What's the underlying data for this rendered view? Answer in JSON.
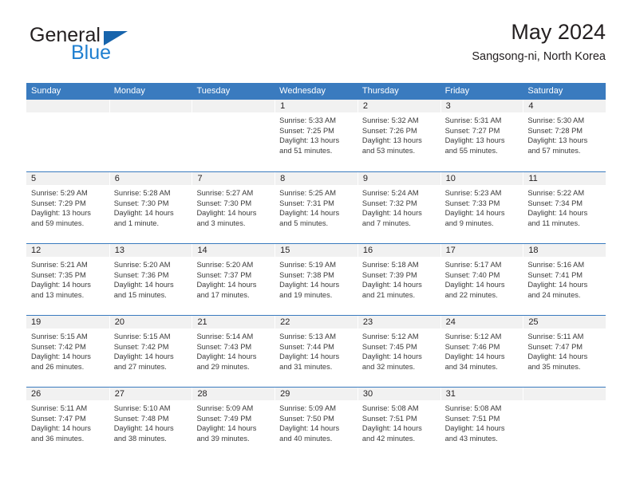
{
  "brand": {
    "name_top": "General",
    "name_bottom": "Blue",
    "accent_color": "#1764ac",
    "text_color": "#1f7fd0"
  },
  "header": {
    "title": "May 2024",
    "location": "Sangsong-ni, North Korea"
  },
  "theme": {
    "header_band": "#3a7bbf",
    "day_band": "#f1f1f1",
    "text": "#231f20",
    "body_text": "#3a3a3a"
  },
  "weekdays": [
    "Sunday",
    "Monday",
    "Tuesday",
    "Wednesday",
    "Thursday",
    "Friday",
    "Saturday"
  ],
  "weeks": [
    [
      {
        "day": "",
        "sunrise": "",
        "sunset": "",
        "daylight1": "",
        "daylight2": ""
      },
      {
        "day": "",
        "sunrise": "",
        "sunset": "",
        "daylight1": "",
        "daylight2": ""
      },
      {
        "day": "",
        "sunrise": "",
        "sunset": "",
        "daylight1": "",
        "daylight2": ""
      },
      {
        "day": "1",
        "sunrise": "Sunrise: 5:33 AM",
        "sunset": "Sunset: 7:25 PM",
        "daylight1": "Daylight: 13 hours",
        "daylight2": "and 51 minutes."
      },
      {
        "day": "2",
        "sunrise": "Sunrise: 5:32 AM",
        "sunset": "Sunset: 7:26 PM",
        "daylight1": "Daylight: 13 hours",
        "daylight2": "and 53 minutes."
      },
      {
        "day": "3",
        "sunrise": "Sunrise: 5:31 AM",
        "sunset": "Sunset: 7:27 PM",
        "daylight1": "Daylight: 13 hours",
        "daylight2": "and 55 minutes."
      },
      {
        "day": "4",
        "sunrise": "Sunrise: 5:30 AM",
        "sunset": "Sunset: 7:28 PM",
        "daylight1": "Daylight: 13 hours",
        "daylight2": "and 57 minutes."
      }
    ],
    [
      {
        "day": "5",
        "sunrise": "Sunrise: 5:29 AM",
        "sunset": "Sunset: 7:29 PM",
        "daylight1": "Daylight: 13 hours",
        "daylight2": "and 59 minutes."
      },
      {
        "day": "6",
        "sunrise": "Sunrise: 5:28 AM",
        "sunset": "Sunset: 7:30 PM",
        "daylight1": "Daylight: 14 hours",
        "daylight2": "and 1 minute."
      },
      {
        "day": "7",
        "sunrise": "Sunrise: 5:27 AM",
        "sunset": "Sunset: 7:30 PM",
        "daylight1": "Daylight: 14 hours",
        "daylight2": "and 3 minutes."
      },
      {
        "day": "8",
        "sunrise": "Sunrise: 5:25 AM",
        "sunset": "Sunset: 7:31 PM",
        "daylight1": "Daylight: 14 hours",
        "daylight2": "and 5 minutes."
      },
      {
        "day": "9",
        "sunrise": "Sunrise: 5:24 AM",
        "sunset": "Sunset: 7:32 PM",
        "daylight1": "Daylight: 14 hours",
        "daylight2": "and 7 minutes."
      },
      {
        "day": "10",
        "sunrise": "Sunrise: 5:23 AM",
        "sunset": "Sunset: 7:33 PM",
        "daylight1": "Daylight: 14 hours",
        "daylight2": "and 9 minutes."
      },
      {
        "day": "11",
        "sunrise": "Sunrise: 5:22 AM",
        "sunset": "Sunset: 7:34 PM",
        "daylight1": "Daylight: 14 hours",
        "daylight2": "and 11 minutes."
      }
    ],
    [
      {
        "day": "12",
        "sunrise": "Sunrise: 5:21 AM",
        "sunset": "Sunset: 7:35 PM",
        "daylight1": "Daylight: 14 hours",
        "daylight2": "and 13 minutes."
      },
      {
        "day": "13",
        "sunrise": "Sunrise: 5:20 AM",
        "sunset": "Sunset: 7:36 PM",
        "daylight1": "Daylight: 14 hours",
        "daylight2": "and 15 minutes."
      },
      {
        "day": "14",
        "sunrise": "Sunrise: 5:20 AM",
        "sunset": "Sunset: 7:37 PM",
        "daylight1": "Daylight: 14 hours",
        "daylight2": "and 17 minutes."
      },
      {
        "day": "15",
        "sunrise": "Sunrise: 5:19 AM",
        "sunset": "Sunset: 7:38 PM",
        "daylight1": "Daylight: 14 hours",
        "daylight2": "and 19 minutes."
      },
      {
        "day": "16",
        "sunrise": "Sunrise: 5:18 AM",
        "sunset": "Sunset: 7:39 PM",
        "daylight1": "Daylight: 14 hours",
        "daylight2": "and 21 minutes."
      },
      {
        "day": "17",
        "sunrise": "Sunrise: 5:17 AM",
        "sunset": "Sunset: 7:40 PM",
        "daylight1": "Daylight: 14 hours",
        "daylight2": "and 22 minutes."
      },
      {
        "day": "18",
        "sunrise": "Sunrise: 5:16 AM",
        "sunset": "Sunset: 7:41 PM",
        "daylight1": "Daylight: 14 hours",
        "daylight2": "and 24 minutes."
      }
    ],
    [
      {
        "day": "19",
        "sunrise": "Sunrise: 5:15 AM",
        "sunset": "Sunset: 7:42 PM",
        "daylight1": "Daylight: 14 hours",
        "daylight2": "and 26 minutes."
      },
      {
        "day": "20",
        "sunrise": "Sunrise: 5:15 AM",
        "sunset": "Sunset: 7:42 PM",
        "daylight1": "Daylight: 14 hours",
        "daylight2": "and 27 minutes."
      },
      {
        "day": "21",
        "sunrise": "Sunrise: 5:14 AM",
        "sunset": "Sunset: 7:43 PM",
        "daylight1": "Daylight: 14 hours",
        "daylight2": "and 29 minutes."
      },
      {
        "day": "22",
        "sunrise": "Sunrise: 5:13 AM",
        "sunset": "Sunset: 7:44 PM",
        "daylight1": "Daylight: 14 hours",
        "daylight2": "and 31 minutes."
      },
      {
        "day": "23",
        "sunrise": "Sunrise: 5:12 AM",
        "sunset": "Sunset: 7:45 PM",
        "daylight1": "Daylight: 14 hours",
        "daylight2": "and 32 minutes."
      },
      {
        "day": "24",
        "sunrise": "Sunrise: 5:12 AM",
        "sunset": "Sunset: 7:46 PM",
        "daylight1": "Daylight: 14 hours",
        "daylight2": "and 34 minutes."
      },
      {
        "day": "25",
        "sunrise": "Sunrise: 5:11 AM",
        "sunset": "Sunset: 7:47 PM",
        "daylight1": "Daylight: 14 hours",
        "daylight2": "and 35 minutes."
      }
    ],
    [
      {
        "day": "26",
        "sunrise": "Sunrise: 5:11 AM",
        "sunset": "Sunset: 7:47 PM",
        "daylight1": "Daylight: 14 hours",
        "daylight2": "and 36 minutes."
      },
      {
        "day": "27",
        "sunrise": "Sunrise: 5:10 AM",
        "sunset": "Sunset: 7:48 PM",
        "daylight1": "Daylight: 14 hours",
        "daylight2": "and 38 minutes."
      },
      {
        "day": "28",
        "sunrise": "Sunrise: 5:09 AM",
        "sunset": "Sunset: 7:49 PM",
        "daylight1": "Daylight: 14 hours",
        "daylight2": "and 39 minutes."
      },
      {
        "day": "29",
        "sunrise": "Sunrise: 5:09 AM",
        "sunset": "Sunset: 7:50 PM",
        "daylight1": "Daylight: 14 hours",
        "daylight2": "and 40 minutes."
      },
      {
        "day": "30",
        "sunrise": "Sunrise: 5:08 AM",
        "sunset": "Sunset: 7:51 PM",
        "daylight1": "Daylight: 14 hours",
        "daylight2": "and 42 minutes."
      },
      {
        "day": "31",
        "sunrise": "Sunrise: 5:08 AM",
        "sunset": "Sunset: 7:51 PM",
        "daylight1": "Daylight: 14 hours",
        "daylight2": "and 43 minutes."
      },
      {
        "day": "",
        "sunrise": "",
        "sunset": "",
        "daylight1": "",
        "daylight2": ""
      }
    ]
  ]
}
